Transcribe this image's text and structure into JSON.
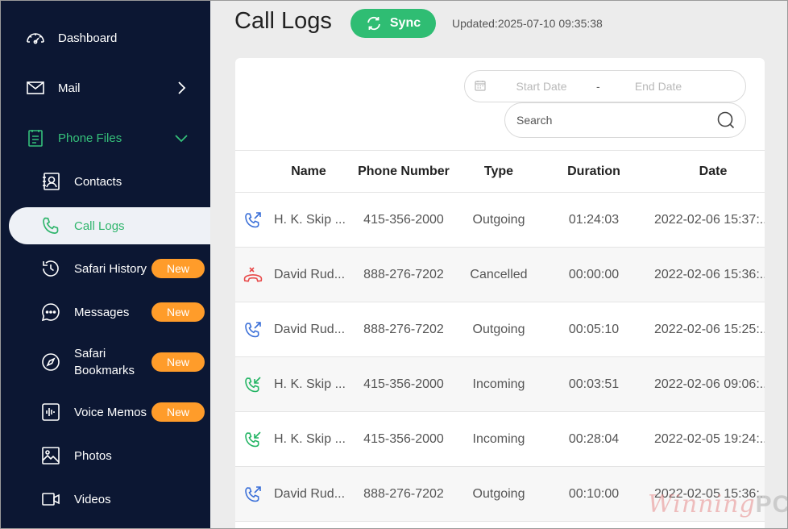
{
  "sidebar": {
    "items": [
      {
        "label": "Dashboard",
        "icon": "dashboard-icon"
      },
      {
        "label": "Mail",
        "icon": "mail-icon"
      },
      {
        "label": "Phone Files",
        "icon": "phone-files-icon"
      },
      {
        "label": "Contacts",
        "icon": "contacts-icon"
      },
      {
        "label": "Call Logs",
        "icon": "phone-icon"
      },
      {
        "label": "Safari History",
        "icon": "history-icon",
        "badge": "New"
      },
      {
        "label": "Messages",
        "icon": "messages-icon",
        "badge": "New"
      },
      {
        "label": "Safari Bookmarks",
        "icon": "compass-icon",
        "badge": "New"
      },
      {
        "label": "Voice Memos",
        "icon": "voice-memo-icon",
        "badge": "New"
      },
      {
        "label": "Photos",
        "icon": "photo-icon"
      },
      {
        "label": "Videos",
        "icon": "video-icon"
      }
    ]
  },
  "header": {
    "title": "Call Logs",
    "sync_label": "Sync",
    "updated": "Updated:2025-07-10 09:35:38"
  },
  "filters": {
    "start_date": "Start Date",
    "separator": "-",
    "end_date": "End Date",
    "search_placeholder": "Search"
  },
  "table": {
    "columns": [
      "Name",
      "Phone Number",
      "Type",
      "Duration",
      "Date"
    ],
    "rows": [
      {
        "name": "H. K. Skip ...",
        "phone": "415-356-2000",
        "type": "Outgoing",
        "duration": "01:24:03",
        "date": "2022-02-06 15:37:..."
      },
      {
        "name": "David Rud...",
        "phone": "888-276-7202",
        "type": "Cancelled",
        "duration": "00:00:00",
        "date": "2022-02-06 15:36:..."
      },
      {
        "name": "David Rud...",
        "phone": "888-276-7202",
        "type": "Outgoing",
        "duration": "00:05:10",
        "date": "2022-02-06 15:25:..."
      },
      {
        "name": "H. K. Skip ...",
        "phone": "415-356-2000",
        "type": "Incoming",
        "duration": "00:03:51",
        "date": "2022-02-06 09:06:..."
      },
      {
        "name": "H. K. Skip ...",
        "phone": "415-356-2000",
        "type": "Incoming",
        "duration": "00:28:04",
        "date": "2022-02-05 19:24:..."
      },
      {
        "name": "David Rud...",
        "phone": "888-276-7202",
        "type": "Outgoing",
        "duration": "00:10:00",
        "date": "2022-02-05 15:36:..."
      }
    ]
  },
  "watermark": {
    "part1": "Winning",
    "part2": "PC"
  },
  "colors": {
    "sidebar_bg": "#0c1733",
    "accent_green": "#2fbd73",
    "badge_orange": "#ff9c2a",
    "outgoing_blue": "#3a6fd8",
    "incoming_green": "#22b463",
    "cancelled_red": "#e84a4a"
  }
}
